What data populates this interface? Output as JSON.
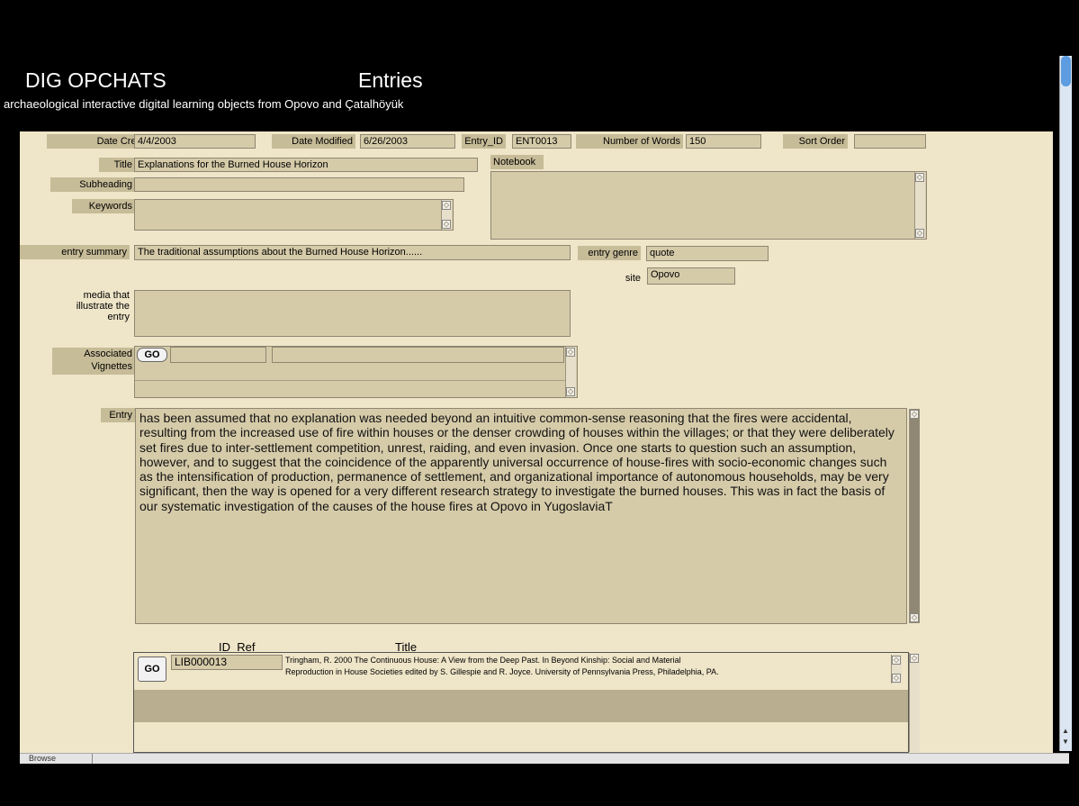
{
  "header": {
    "app_title": "DIG OPCHATS",
    "section_title": "Entries",
    "subtitle": "archaeological interactive digital learning objects from Opovo and Çatalhöyük"
  },
  "fields": {
    "date_created": {
      "label": "Date Created",
      "value": "4/4/2003"
    },
    "date_modified": {
      "label": "Date Modified",
      "value": "6/26/2003"
    },
    "entry_id": {
      "label": "Entry_ID",
      "value": "ENT0013"
    },
    "number_of_words": {
      "label": "Number of Words",
      "value": "150"
    },
    "sort_order": {
      "label": "Sort Order",
      "value": ""
    },
    "title": {
      "label": "Title",
      "value": "Explanations for the Burned House Horizon"
    },
    "notebook": {
      "label": "Notebook",
      "value": ""
    },
    "subheading": {
      "label": "Subheading",
      "value": ""
    },
    "keywords": {
      "label": "Keywords",
      "value": ""
    },
    "entry_summary": {
      "label": "entry summary",
      "value": "The traditional assumptions about the Burned House Horizon......"
    },
    "entry_genre": {
      "label": "entry genre",
      "value": "quote"
    },
    "site": {
      "label": "site",
      "value": "Opovo"
    },
    "media": {
      "label": "media that illustrate the entry",
      "value": ""
    },
    "associated_vignettes": {
      "label": "Associated Vignettes",
      "go_label": "GO"
    },
    "entry": {
      "label": "Entry",
      "value": "has been assumed that no explanation was needed beyond an intuitive common-sense reasoning that the fires were accidental, resulting from the increased use of fire within houses or the denser crowding of houses within the villages; or that they were deliberately set fires due to inter-settlement competition, unrest, raiding, and even  invasion. Once one starts to question such an assumption, however, and to suggest that the coincidence of the apparently universal occurrence of  house-fires  with socio-economic changes such as the intensification of production, permanence of settlement, and organizational importance of autonomous households, may be very significant, then the way is opened for a very different research strategy to investigate the burned houses.  This was in fact the basis of our systematic investigation of the causes of the house fires  at Opovo in YugoslaviaT"
    }
  },
  "references": {
    "col_id": "ID_Ref",
    "col_title": "Title",
    "go_label": "GO",
    "rows": [
      {
        "id": "LIB000013",
        "title_line1": "Tringham, R. 2000   The Continuous House: A View from the Deep Past. In Beyond Kinship: Social and Material",
        "title_line2": "Reproduction in House Societies edited by S. Gillespie and R. Joyce. University of Pennsylvania Press, Philadelphia, PA."
      }
    ]
  },
  "status_bar": {
    "mode": "Browse"
  }
}
